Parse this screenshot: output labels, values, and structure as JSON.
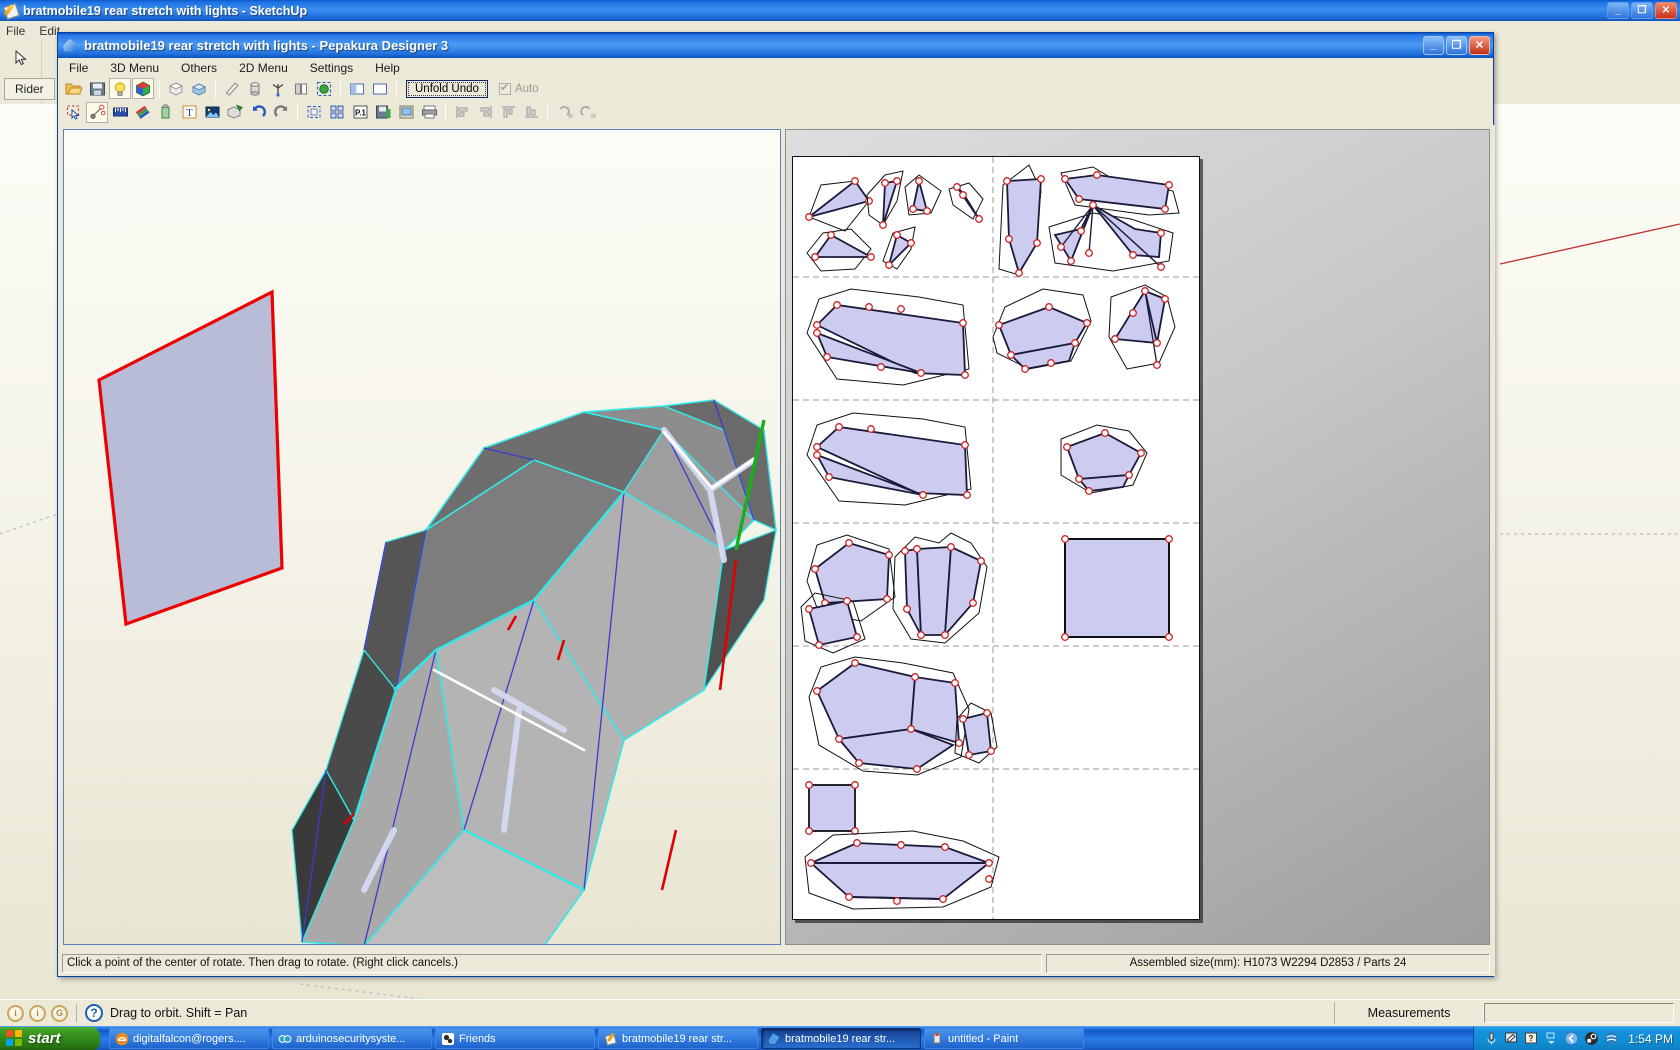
{
  "sketchup": {
    "title": "bratmobile19 rear stretch with lights - SketchUp",
    "menus": [
      "File",
      "Edit"
    ],
    "tab_label": "Rider",
    "tools": [
      "select-arrow-tool",
      "eraser-tool"
    ],
    "statusbar": {
      "hint": "Drag to orbit.  Shift = Pan",
      "measurements_label": "Measurements",
      "measurements_value": "",
      "circles": [
        "person-icon",
        "person-icon",
        "globe-icon"
      ],
      "help": "?"
    },
    "window_buttons": {
      "minimize": "_",
      "maximize": "❐",
      "close": "✕"
    }
  },
  "pepakura": {
    "title": "bratmobile19 rear stretch with lights - Pepakura Designer 3",
    "menus": [
      "File",
      "3D Menu",
      "Others",
      "2D Menu",
      "Settings",
      "Help"
    ],
    "window_buttons": {
      "minimize": "_",
      "maximize": "❐",
      "close": "✕"
    },
    "toolbar_row1": [
      {
        "name": "open-file-icon",
        "glyph": "folder"
      },
      {
        "name": "save-file-icon",
        "glyph": "floppy"
      },
      {
        "name": "light-bulb-icon",
        "glyph": "bulb",
        "active": true
      },
      {
        "name": "texture-cube-icon",
        "glyph": "rgbcube",
        "active": true
      },
      {
        "name": "flat-shade-icon",
        "glyph": "cube-gray"
      },
      {
        "name": "smooth-shade-icon",
        "glyph": "cube-blue"
      },
      {
        "name": "edge-eraser-icon",
        "glyph": "pencil"
      },
      {
        "name": "cylinder-icon",
        "glyph": "cylinder"
      },
      {
        "name": "axis-icon",
        "glyph": "axis"
      },
      {
        "name": "flip-face-icon",
        "glyph": "flipface"
      },
      {
        "name": "select-region-icon",
        "glyph": "selregion"
      },
      {
        "name": "split-horizontal-icon",
        "glyph": "splith"
      },
      {
        "name": "split-vertical-icon",
        "glyph": "splitv"
      }
    ],
    "unfold_undo_label": "Unfold Undo",
    "auto_label": "Auto",
    "auto_checked": true,
    "toolbar_row2": [
      {
        "name": "select-tool-icon",
        "glyph": "selarrow"
      },
      {
        "name": "edge-connect-icon",
        "glyph": "nodes",
        "active": true
      },
      {
        "name": "ruler-icon",
        "glyph": "ruler"
      },
      {
        "name": "paint-flaps-icon",
        "glyph": "markers"
      },
      {
        "name": "glue-tab-icon",
        "glyph": "bottle"
      },
      {
        "name": "add-text-icon",
        "glyph": "textT"
      },
      {
        "name": "image-icon",
        "glyph": "picture"
      },
      {
        "name": "unfold-icon",
        "glyph": "unfoldbox"
      },
      {
        "name": "rotate-left-icon",
        "glyph": "undoarrow"
      },
      {
        "name": "rotate-right-icon",
        "glyph": "redoarrow"
      },
      {
        "name": "select-all-icon",
        "glyph": "marquee"
      },
      {
        "name": "arrange-parts-icon",
        "glyph": "arrange"
      },
      {
        "name": "page-setup-icon",
        "glyph": "p1"
      },
      {
        "name": "save-pattern-icon",
        "glyph": "floppy-green"
      },
      {
        "name": "export-image-icon",
        "glyph": "exportimg"
      },
      {
        "name": "print-icon",
        "glyph": "printer"
      },
      {
        "name": "align-left-icon",
        "glyph": "alignleft"
      },
      {
        "name": "align-right-icon",
        "glyph": "alignright"
      },
      {
        "name": "align-top-icon",
        "glyph": "aligntop"
      },
      {
        "name": "align-bottom-icon",
        "glyph": "alignbottom"
      },
      {
        "name": "rotate-90-ccw-icon",
        "glyph": "rot90a"
      },
      {
        "name": "rotate-90-cw-icon",
        "glyph": "rot90b"
      }
    ],
    "statusbar": {
      "hint": "Click a point of the center of rotate. Then drag to rotate. (Right click cancels.)",
      "assembled": "Assembled size(mm): H1073 W2294 D2853 / Parts 24"
    }
  },
  "taskbar": {
    "start_label": "start",
    "items": [
      {
        "label": "digitalfalcon@rogers....",
        "icon": "mail-icon",
        "active": false
      },
      {
        "label": "arduinosecuritysyste...",
        "icon": "browser-icon",
        "active": false
      },
      {
        "label": "Friends",
        "icon": "messenger-icon",
        "active": false
      },
      {
        "label": "bratmobile19 rear str...",
        "icon": "sketchup-icon",
        "active": false
      },
      {
        "label": "bratmobile19 rear str...",
        "icon": "pepakura-icon",
        "active": true
      },
      {
        "label": "untitled - Paint",
        "icon": "paint-icon",
        "active": false
      }
    ],
    "tray_icons": [
      "mic-icon",
      "pen-icon",
      "help-icon",
      "expand-icon",
      "shield-icon",
      "steam-icon",
      "network-icon"
    ],
    "clock": "1:54 PM"
  },
  "colors": {
    "title_blue": "#1b6fe0",
    "face_lavender": "#ccccf0",
    "vertex_red": "#cc2222",
    "selection_red": "#ee0000",
    "model_cyan": "#33e8e8",
    "model_blue": "#3a3ad0",
    "model_green": "#18b018"
  }
}
